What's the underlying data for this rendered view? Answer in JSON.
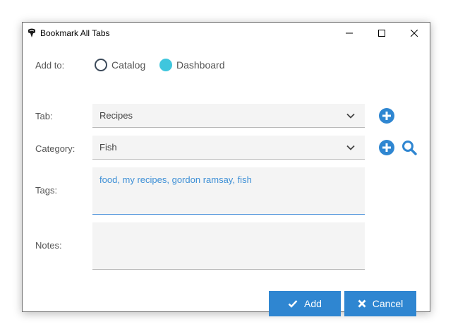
{
  "window": {
    "title": "Bookmark All Tabs",
    "icon": "bookmark-app-icon"
  },
  "controls": {
    "minimize": "minimize-icon",
    "maximize": "maximize-icon",
    "close": "close-icon"
  },
  "form": {
    "add_to_label": "Add to:",
    "add_to_options": [
      {
        "label": "Catalog",
        "selected": false
      },
      {
        "label": "Dashboard",
        "selected": true
      }
    ],
    "tab_label": "Tab:",
    "tab_value": "Recipes",
    "category_label": "Category:",
    "category_value": "Fish",
    "tags_label": "Tags:",
    "tags_value": "food, my recipes, gordon ramsay, fish",
    "notes_label": "Notes:",
    "notes_value": ""
  },
  "buttons": {
    "add_label": "Add",
    "cancel_label": "Cancel"
  },
  "colors": {
    "accent_blue": "#2f86d1",
    "radio_selected": "#3fc6dd",
    "tag_text": "#3d8fd6"
  }
}
